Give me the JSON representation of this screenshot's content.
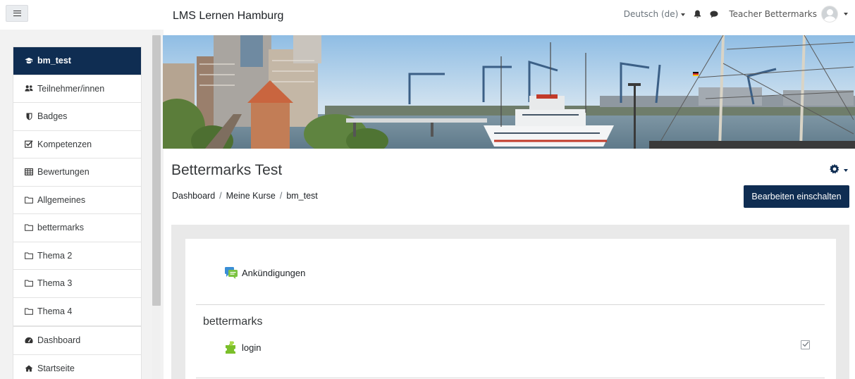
{
  "navbar": {
    "site_name": "LMS Lernen Hamburg",
    "language": "Deutsch (de)",
    "user_name": "Teacher Bettermarks"
  },
  "drawer": {
    "course_items": [
      {
        "label": "bm_test",
        "icon": "graduation-cap-icon",
        "active": true
      },
      {
        "label": "Teilnehmer/innen",
        "icon": "users-icon",
        "active": false
      },
      {
        "label": "Badges",
        "icon": "shield-icon",
        "active": false
      },
      {
        "label": "Kompetenzen",
        "icon": "checkbox-icon",
        "active": false
      },
      {
        "label": "Bewertungen",
        "icon": "table-icon",
        "active": false
      },
      {
        "label": "Allgemeines",
        "icon": "folder-icon",
        "active": false
      },
      {
        "label": "bettermarks",
        "icon": "folder-icon",
        "active": false
      },
      {
        "label": "Thema 2",
        "icon": "folder-icon",
        "active": false
      },
      {
        "label": "Thema 3",
        "icon": "folder-icon",
        "active": false
      },
      {
        "label": "Thema 4",
        "icon": "folder-icon",
        "active": false
      }
    ],
    "site_items": [
      {
        "label": "Dashboard",
        "icon": "dashboard-icon"
      },
      {
        "label": "Startseite",
        "icon": "home-icon"
      }
    ]
  },
  "page": {
    "title": "Bettermarks Test",
    "breadcrumb": [
      "Dashboard",
      "Meine Kurse",
      "bm_test"
    ],
    "breadcrumb_separator": "/",
    "edit_button": "Bearbeiten einschalten"
  },
  "course": {
    "announcements": "Ankündigungen",
    "section_title": "bettermarks",
    "activity_label": "login"
  },
  "colors": {
    "brand": "#0f2d52",
    "drawer_bg": "#f2f2f2",
    "region_bg": "#e9e9e9"
  }
}
